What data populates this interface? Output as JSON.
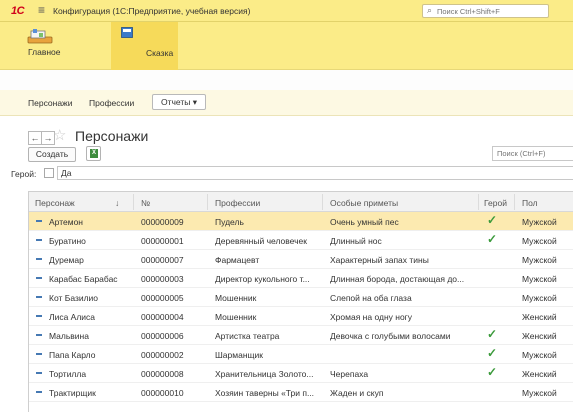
{
  "titlebar": {
    "logo": "1С",
    "title": "Конфигурация  (1С:Предприятие, учебная версия)",
    "search_placeholder": "Поиск Ctrl+Shift+F"
  },
  "sections": {
    "home_label": "Главное",
    "skazka_label": "Сказка"
  },
  "subnav": {
    "characters": "Персонажи",
    "professions": "Профессии",
    "reports": "Отчеты ▾"
  },
  "form": {
    "back": "←",
    "forward": "→",
    "title": "Персонажи",
    "create_label": "Создать",
    "search_placeholder": "Поиск (Ctrl+F)",
    "filter_label": "Герой:",
    "filter_value": "Да"
  },
  "table": {
    "columns": [
      "Персонаж",
      "↓",
      "№",
      "Профессии",
      "Особые приметы",
      "Герой",
      "Пол"
    ],
    "rows": [
      {
        "name": "Артемон",
        "num": "000000009",
        "prof": "Пудель",
        "signs": "Очень умный пес",
        "hero": "✓",
        "sex": "Мужской"
      },
      {
        "name": "Буратино",
        "num": "000000001",
        "prof": "Деревянный человечек",
        "signs": "Длинный нос",
        "hero": "✓",
        "sex": "Мужской"
      },
      {
        "name": "Дуремар",
        "num": "000000007",
        "prof": "Фармацевт",
        "signs": "Характерный запах тины",
        "hero": "",
        "sex": "Мужской"
      },
      {
        "name": "Карабас Барабас",
        "num": "000000003",
        "prof": "Директор кукольного т...",
        "signs": "Длинная борода, достающая до...",
        "hero": "",
        "sex": "Мужской"
      },
      {
        "name": "Кот Базилио",
        "num": "000000005",
        "prof": "Мошенник",
        "signs": "Слепой на оба глаза",
        "hero": "",
        "sex": "Мужской"
      },
      {
        "name": "Лиса Алиса",
        "num": "000000004",
        "prof": "Мошенник",
        "signs": "Хромая на одну ногу",
        "hero": "",
        "sex": "Женский"
      },
      {
        "name": "Мальвина",
        "num": "000000006",
        "prof": "Артистка театра",
        "signs": "Девочка с голубыми волосами",
        "hero": "✓",
        "sex": "Женский"
      },
      {
        "name": "Папа Карло",
        "num": "000000002",
        "prof": "Шарманщик",
        "signs": "",
        "hero": "✓",
        "sex": "Мужской"
      },
      {
        "name": "Тортилла",
        "num": "000000008",
        "prof": "Хранительница Золото...",
        "signs": "Черепаха",
        "hero": "✓",
        "sex": "Женский"
      },
      {
        "name": "Трактирщик",
        "num": "000000010",
        "prof": "Хозяин таверны «Три п...",
        "signs": "Жаден и скуп",
        "hero": "",
        "sex": "Мужской"
      }
    ]
  }
}
